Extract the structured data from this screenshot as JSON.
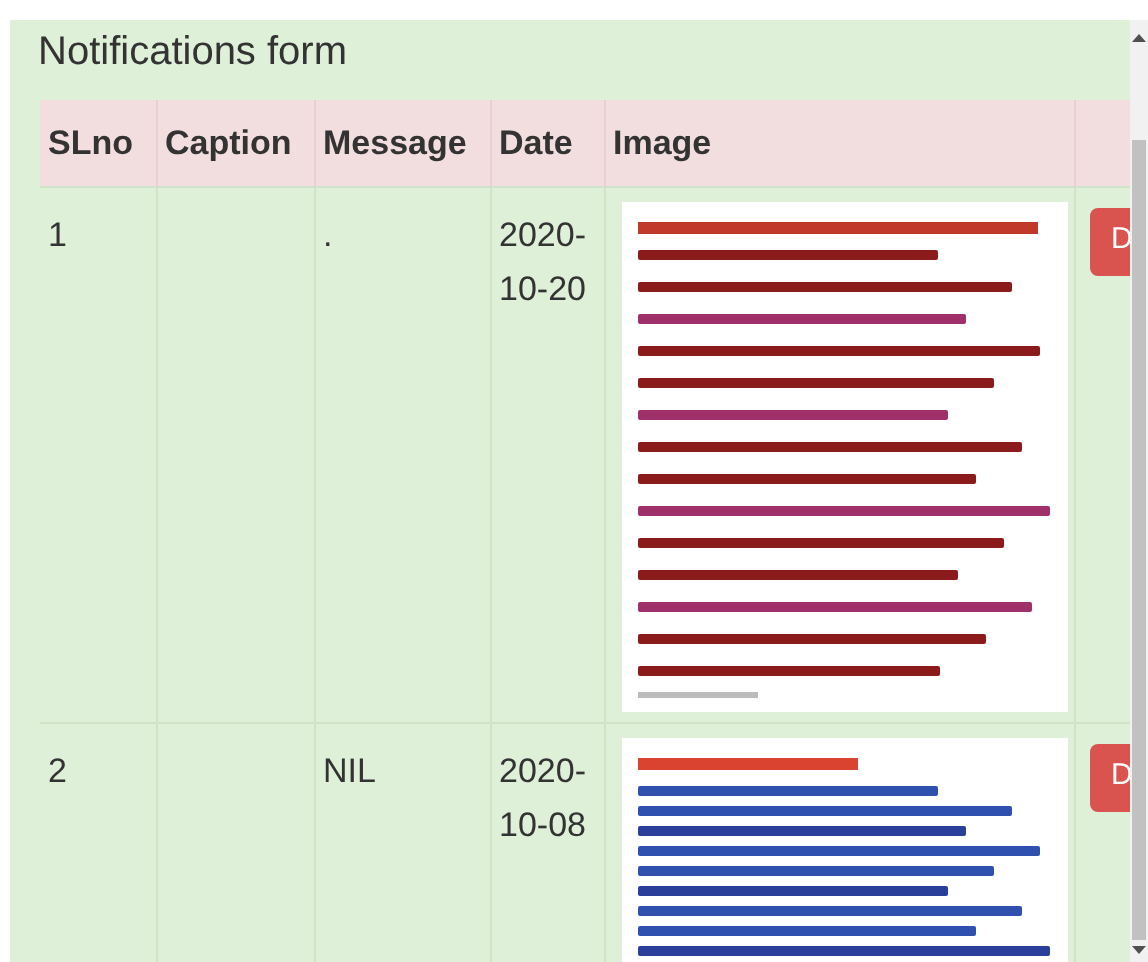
{
  "title": "Notifications form",
  "table": {
    "columns": [
      "SLno",
      "Caption",
      "Message",
      "Date",
      "Image"
    ],
    "rows": [
      {
        "slno": "1",
        "caption": "",
        "message": ".",
        "date": "2020-10-20",
        "action": "D"
      },
      {
        "slno": "2",
        "caption": "",
        "message": "NIL",
        "date": "2020-10-08",
        "action": "D"
      }
    ]
  }
}
